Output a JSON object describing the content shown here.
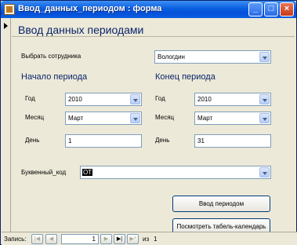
{
  "window": {
    "title": "Ввод_данных_периодом : форма"
  },
  "form": {
    "title": "Ввод данных периодами",
    "employee_label": "Выбрать сотрудника",
    "employee_value": "Вологдин",
    "start": {
      "heading": "Начало периода",
      "year_label": "Год",
      "year_value": "2010",
      "month_label": "Месяц",
      "month_value": "Март",
      "day_label": "День",
      "day_value": "1"
    },
    "end": {
      "heading": "Конец периода",
      "year_label": "Год",
      "year_value": "2010",
      "month_label": "Месяц",
      "month_value": "Март",
      "day_label": "День",
      "day_value": "31"
    },
    "code_label": "Буквенный_код",
    "code_value": "ОТ",
    "submit_label": "Ввод периодом",
    "calendar_label": "Посмотреть табель-календарь"
  },
  "nav": {
    "record_label": "Запись:",
    "first": "|◀",
    "prev": "◀",
    "next": "▶",
    "last": "▶|",
    "new": "▶*",
    "current": "1",
    "of_label": "из",
    "total": "1"
  }
}
